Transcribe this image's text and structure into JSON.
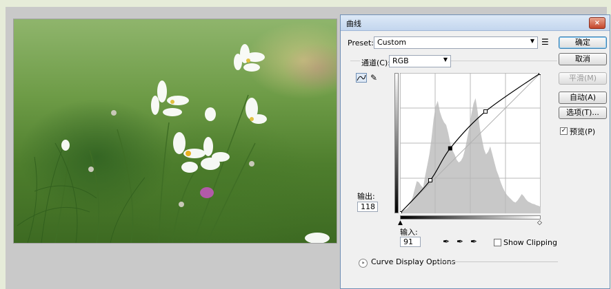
{
  "dialog": {
    "title": "曲线",
    "preset_label": "Preset:",
    "preset_value": "Custom",
    "channel_label": "通道(C):",
    "channel_value": "RGB",
    "output_label": "输出:",
    "output_value": "118",
    "input_label": "输入:",
    "input_value": "91",
    "show_clipping_label": "Show Clipping",
    "curve_display_label": "Curve Display Options",
    "preview_label": "预览(P)",
    "preview_checked": true,
    "close_glyph": "×"
  },
  "buttons": {
    "ok": "确定",
    "cancel": "取消",
    "smooth": "平滑(M)",
    "auto": "自动(A)",
    "options": "选项(T)..."
  },
  "icons": {
    "preset_menu": "list-menu-icon",
    "curve_tool": "curve-point-icon",
    "pencil_tool": "pencil-icon",
    "eyedroppers": [
      "black-eyedropper-icon",
      "gray-eyedropper-icon",
      "white-eyedropper-icon"
    ],
    "expand": "expand-chevron-icon"
  },
  "colors": {
    "ok_border": "#3c7fb1",
    "close_red": "#c4452b",
    "curve": "#000000",
    "histogram": "#c8c8c8"
  },
  "curve": {
    "range": [
      0,
      255
    ],
    "points": [
      [
        0,
        0
      ],
      [
        55,
        60
      ],
      [
        91,
        118
      ],
      [
        155,
        185
      ],
      [
        255,
        255
      ]
    ]
  },
  "histogram": [
    3,
    4,
    6,
    8,
    12,
    18,
    30,
    45,
    60,
    58,
    52,
    48,
    70,
    90,
    110,
    140,
    175,
    200,
    210,
    190,
    178,
    170,
    165,
    150,
    130,
    118,
    110,
    100,
    95,
    98,
    105,
    120,
    140,
    160,
    185,
    205,
    215,
    190,
    160,
    140,
    120,
    110,
    115,
    125,
    110,
    95,
    80,
    70,
    58,
    48,
    40,
    34,
    30,
    26,
    22,
    20,
    24,
    30,
    36,
    32,
    26,
    22,
    20,
    18,
    17,
    15,
    14,
    12
  ]
}
